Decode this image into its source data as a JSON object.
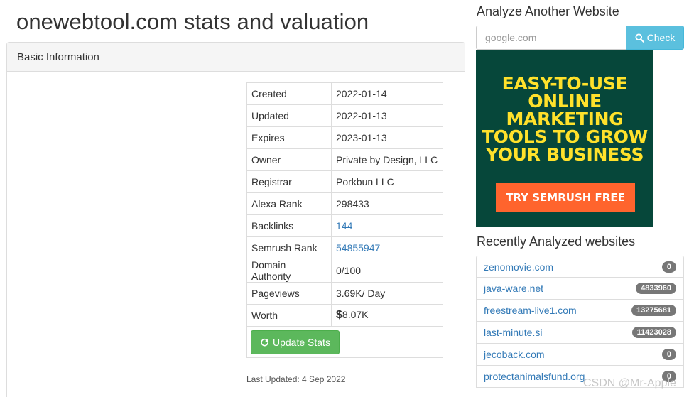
{
  "page": {
    "title": "onewebtool.com stats and valuation"
  },
  "panel": {
    "heading": "Basic Information"
  },
  "stats": {
    "rows": [
      {
        "key": "Created",
        "value": "2022-01-14"
      },
      {
        "key": "Updated",
        "value": "2022-01-13"
      },
      {
        "key": "Expires",
        "value": "2023-01-13"
      },
      {
        "key": "Owner",
        "value": "Private by Design, LLC"
      },
      {
        "key": "Registrar",
        "value": "Porkbun LLC"
      },
      {
        "key": "Alexa Rank",
        "value": "298433"
      },
      {
        "key": "Backlinks",
        "value": "144"
      },
      {
        "key": "Semrush Rank",
        "value": "54855947"
      },
      {
        "key": "Domain Authority",
        "value": "0/100"
      },
      {
        "key": "Pageviews",
        "value": "3.69K/ Day"
      }
    ],
    "worth_label": "Worth",
    "worth_currency": "$",
    "worth_value": "8.07K",
    "update_button": "Update Stats",
    "last_updated": "Last Updated: 4 Sep 2022"
  },
  "sidebar": {
    "analyze_title": "Analyze Another Website",
    "search_placeholder": "google.com",
    "check_button": "Check",
    "ad": {
      "line1": "EASY-TO-USE",
      "line2": "ONLINE",
      "line3": "MARKETING",
      "line4": "TOOLS TO GROW",
      "line5": "YOUR BUSINESS",
      "cta": "TRY SEMRUSH FREE"
    },
    "recent_title": "Recently Analyzed websites",
    "recent": [
      {
        "site": "zenomovie.com",
        "count": "0"
      },
      {
        "site": "java-ware.net",
        "count": "4833960"
      },
      {
        "site": "freestream-live1.com",
        "count": "13275681"
      },
      {
        "site": "last-minute.si",
        "count": "11423028"
      },
      {
        "site": "jecoback.com",
        "count": "0"
      },
      {
        "site": "protectanimalsfund.org",
        "count": "0"
      }
    ]
  },
  "watermark": "CSDN @Mr-Apple",
  "colors": {
    "success": "#5cb85c",
    "info": "#5bc0de",
    "link": "#337ab7",
    "ad_bg": "#06473a",
    "ad_text": "#ffe12b",
    "ad_cta": "#ff642d"
  }
}
